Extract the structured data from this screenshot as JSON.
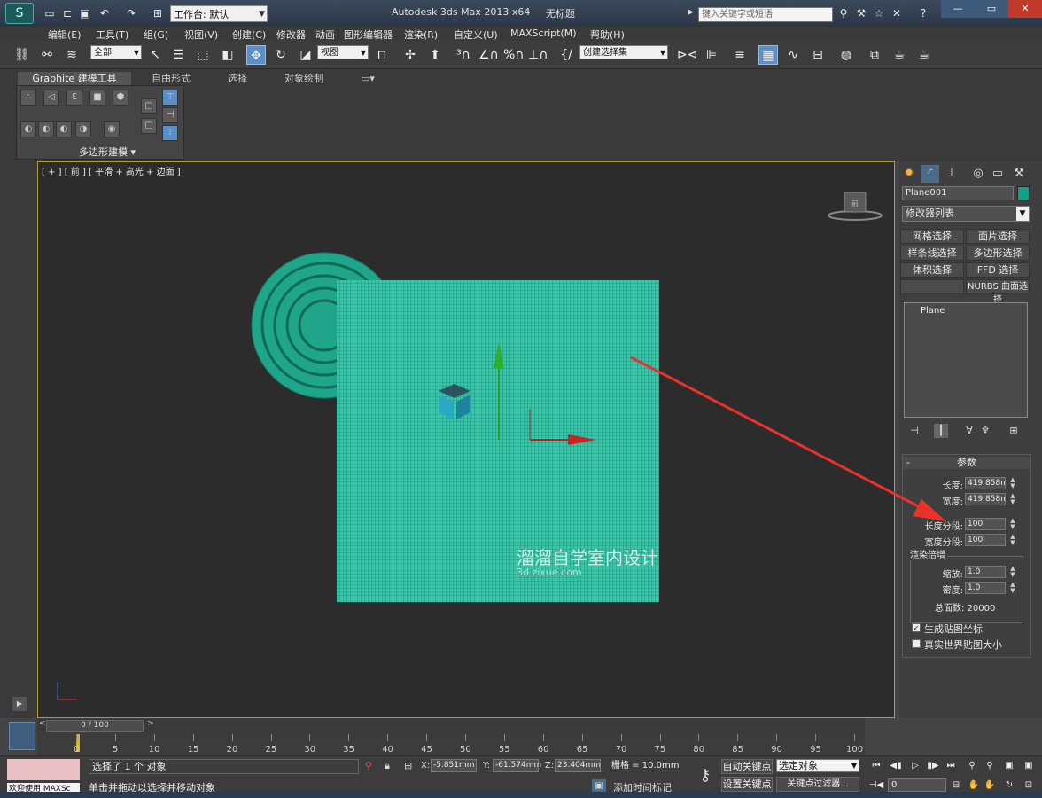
{
  "titlebar": {
    "workspace_value": "工作台: 默认",
    "app_title": "Autodesk 3ds Max  2013 x64",
    "doc_title": "无标题",
    "search_placeholder": "键入关键字或短语"
  },
  "menus": [
    "编辑(E)",
    "工具(T)",
    "组(G)",
    "视图(V)",
    "创建(C)",
    "修改器",
    "动画",
    "图形编辑器",
    "渲染(R)",
    "自定义(U)",
    "MAXScript(M)",
    "帮助(H)"
  ],
  "toolbar": {
    "selection_filter": "全部",
    "ref_coord": "视图",
    "named_selection": "创建选择集"
  },
  "ribbon": {
    "tabs": [
      "Graphite 建模工具",
      "自由形式",
      "选择",
      "对象绘制"
    ],
    "panel_label": "多边形建模"
  },
  "viewport": {
    "label": "[ + ] [ 前 ] [ 平滑 + 高光 + 边面 ]",
    "watermark_text": "溜溜自学室内设计",
    "watermark_url": "3d.zixue.com"
  },
  "command_panel": {
    "object_name": "Plane001",
    "object_color": "#14a085",
    "modifier_list": "修改器列表",
    "modifier_buttons": [
      "网格选择",
      "面片选择",
      "样条线选择",
      "多边形选择",
      "体积选择",
      "FFD 选择",
      "NURBS 曲面选择"
    ],
    "stack_item": "Plane",
    "rollout_title": "参数",
    "params": {
      "length_label": "长度:",
      "length_value": "419.858m",
      "width_label": "宽度:",
      "width_value": "419.858m",
      "length_segs_label": "长度分段:",
      "length_segs_value": "100",
      "width_segs_label": "宽度分段:",
      "width_segs_value": "100"
    },
    "render_multipliers": {
      "title": "渲染倍增",
      "scale_label": "缩放:",
      "scale_value": "1.0",
      "density_label": "密度:",
      "density_value": "1.0",
      "total_faces": "总面数: 20000"
    },
    "checkboxes": [
      {
        "label": "生成贴图坐标",
        "checked": true
      },
      {
        "label": "真实世界贴图大小",
        "checked": false
      }
    ]
  },
  "timeline": {
    "slider_label": "0 / 100",
    "ticks": [
      "0",
      "5",
      "10",
      "15",
      "20",
      "25",
      "30",
      "35",
      "40",
      "45",
      "50",
      "55",
      "60",
      "65",
      "70",
      "75",
      "80",
      "85",
      "90",
      "95",
      "100"
    ]
  },
  "status": {
    "welcome": "欢迎使用 MAXSc",
    "selection_info": "选择了 1 个 对象",
    "prompt": "单击并拖动以选择并移动对象",
    "x_label": "X:",
    "x_value": "-5.851mm",
    "y_label": "Y:",
    "y_value": "-61.574mm",
    "z_label": "Z:",
    "z_value": "23.404mm",
    "grid": "栅格 = 10.0mm",
    "add_time_tag": "添加时间标记",
    "auto_key": "自动关键点",
    "set_key": "设置关键点",
    "selected_set": "选定对象",
    "key_filters": "关键点过滤器...",
    "frame": "0"
  },
  "annotation": {
    "color": "#e8322a"
  }
}
